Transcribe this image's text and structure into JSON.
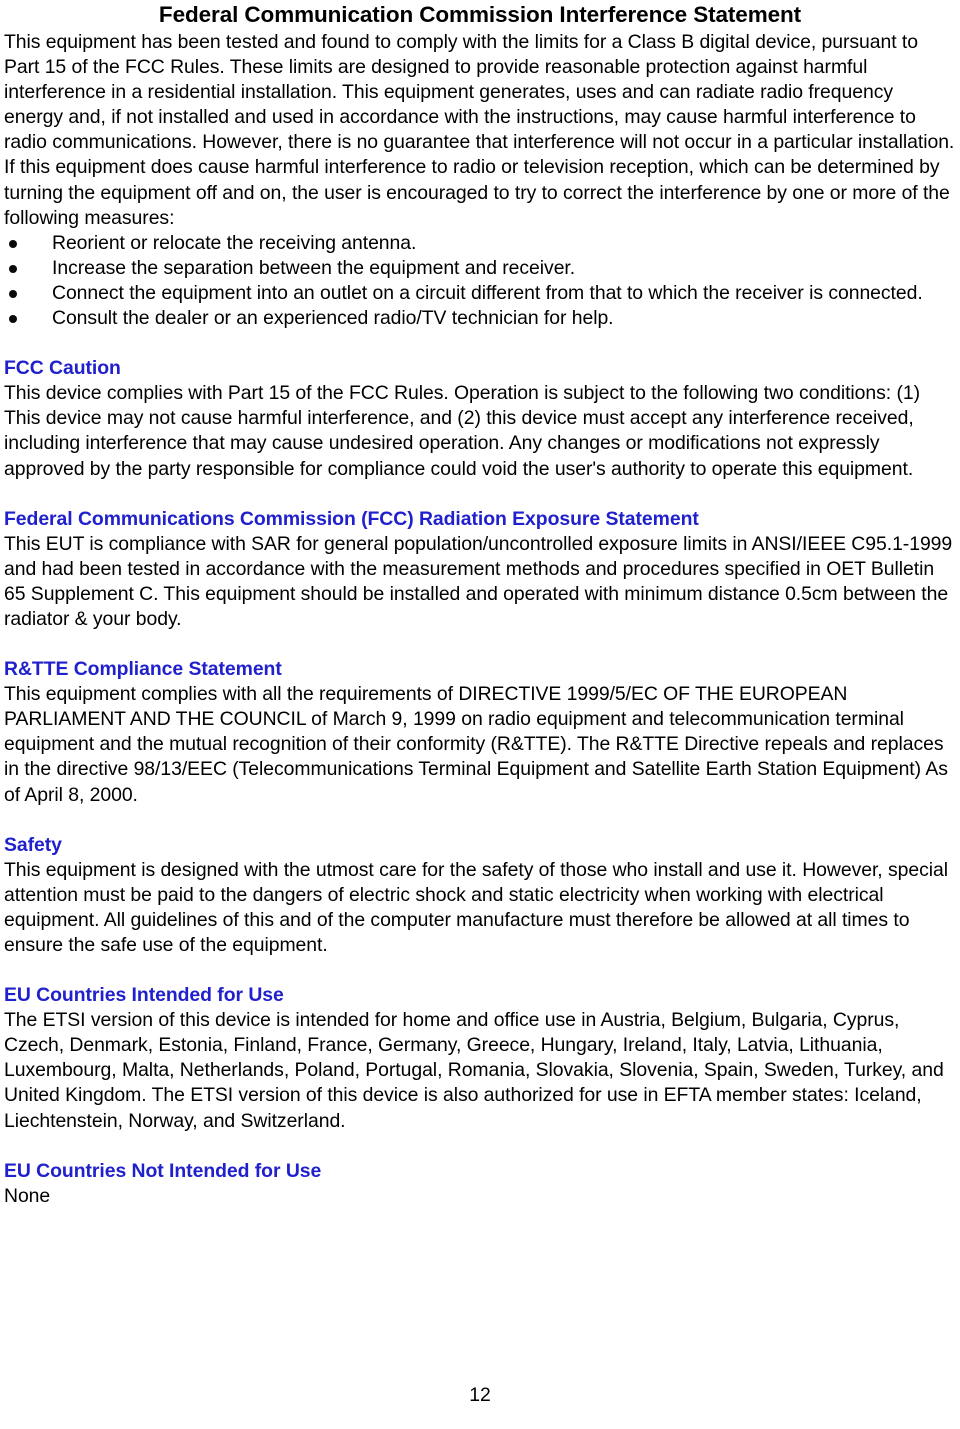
{
  "document": {
    "title": "Federal Communication Commission Interference Statement",
    "page_number": "12",
    "heading_color": "#2020CC",
    "body_color": "#000000"
  },
  "intro": {
    "paragraph": "This equipment has been tested and found to comply with the limits for a Class B digital device, pursuant to Part 15 of the FCC Rules.   These limits are designed to provide reasonable protection against harmful interference in a residential installation.   This equipment generates, uses and can radiate radio frequency energy and, if not installed and used in accordance with the instructions, may cause harmful interference to radio communications.   However, there is no guarantee that interference will not occur in a particular installation.   If this equipment does cause harmful interference to radio or television reception, which can be determined by turning the equipment off and on, the user is encouraged to try to correct the interference by one or more of the following measures:",
    "bullets": [
      "Reorient or relocate the receiving antenna.",
      "Increase the separation between the equipment and receiver.",
      "Connect the equipment into an outlet on a circuit different from that to which the receiver is connected.",
      "Consult the dealer or an experienced radio/TV technician for help."
    ]
  },
  "sections": [
    {
      "heading": "FCC Caution",
      "body": "This device complies with Part 15 of the FCC Rules. Operation is subject to the following two conditions: (1) This device may not cause harmful interference, and (2) this device must accept any interference received, including interference that may cause undesired operation.   Any changes or modifications not expressly approved by the party responsible for compliance could void the user's authority to operate this equipment."
    },
    {
      "heading": "Federal Communications Commission (FCC) Radiation Exposure Statement",
      "body": "This EUT is compliance with SAR for general population/uncontrolled exposure limits in ANSI/IEEE C95.1-1999 and had been tested in accordance with the measurement methods and procedures specified in OET Bulletin 65 Supplement C. This equipment should be installed and operated with minimum distance 0.5cm between the radiator & your body."
    },
    {
      "heading": "R&TTE Compliance Statement",
      "body": "This equipment complies with all the requirements of DIRECTIVE 1999/5/EC OF THE EUROPEAN PARLIAMENT AND THE COUNCIL of March 9, 1999 on radio equipment and telecommunication terminal equipment and the mutual recognition of their conformity (R&TTE). The R&TTE Directive repeals and replaces in the directive 98/13/EEC (Telecommunications Terminal Equipment and Satellite Earth Station Equipment) As of April 8, 2000."
    },
    {
      "heading": "Safety",
      "body": "This equipment is designed with the utmost care for the safety of those who install and use it. However, special attention must be paid to the dangers of electric shock and static electricity when working with electrical equipment. All guidelines of this and of the computer manufacture must therefore be allowed at all times to ensure the safe use of the equipment."
    },
    {
      "heading": "EU Countries Intended for Use",
      "body": "The ETSI version of this device is intended for home and office use in Austria, Belgium, Bulgaria, Cyprus, Czech, Denmark, Estonia, Finland, France, Germany, Greece, Hungary, Ireland, Italy, Latvia, Lithuania, Luxembourg, Malta, Netherlands, Poland, Portugal, Romania, Slovakia, Slovenia, Spain, Sweden, Turkey, and United Kingdom. The ETSI version of this device is also authorized for use in EFTA member states: Iceland, Liechtenstein, Norway, and Switzerland."
    },
    {
      "heading": "EU Countries Not Intended for Use",
      "body": "None"
    }
  ]
}
